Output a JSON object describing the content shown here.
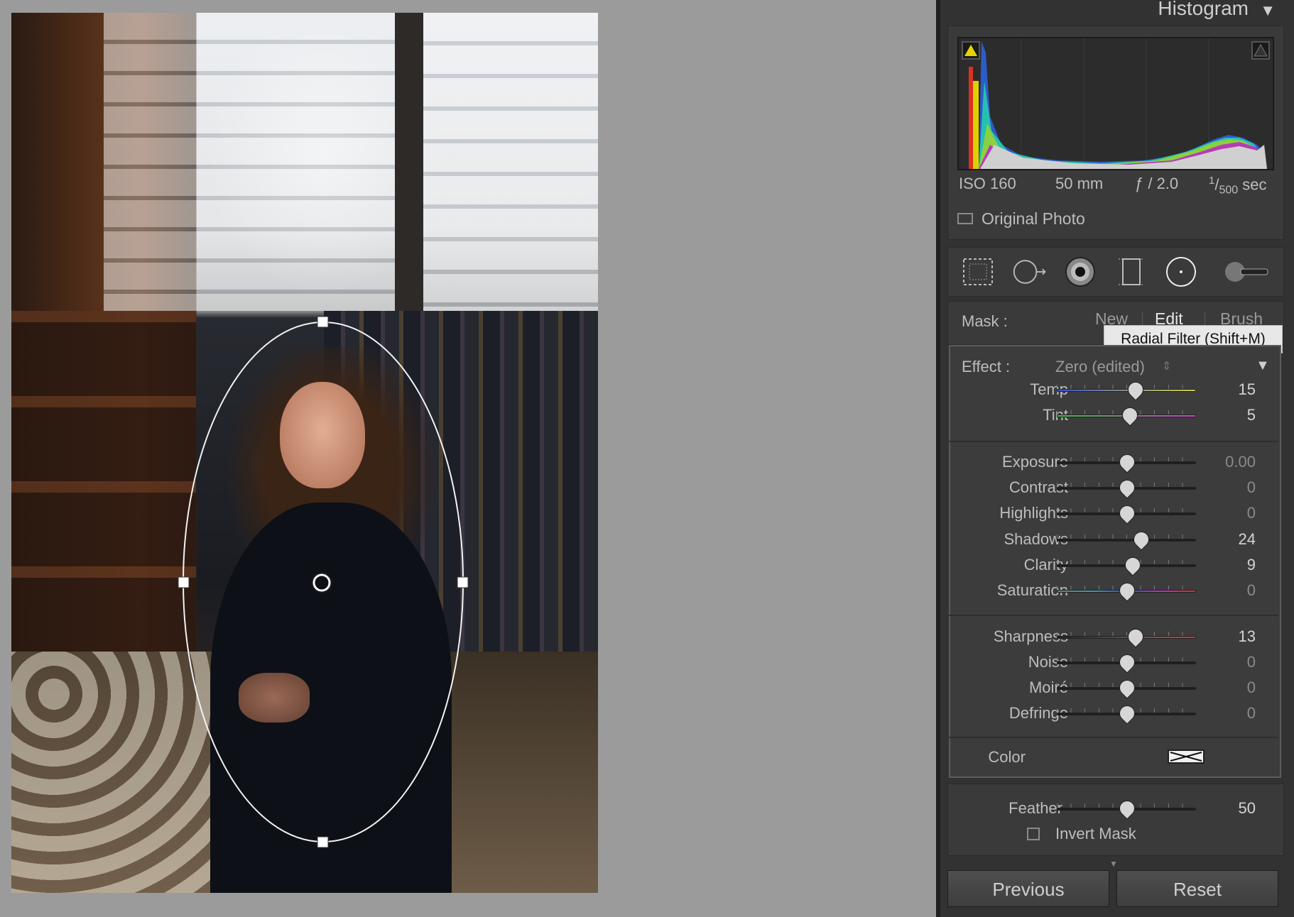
{
  "histogram": {
    "title": "Histogram",
    "collapse_glyph": "▼",
    "exif": {
      "iso": "ISO 160",
      "focal": "50 mm",
      "aperture": "ƒ / 2.0",
      "shutter_num": "1",
      "shutter_den": "500",
      "shutter_unit": "sec"
    },
    "original_photo_label": "Original Photo"
  },
  "tools": [
    "crop-overlay-icon",
    "spot-removal-icon",
    "red-eye-icon",
    "graduated-filter-icon",
    "radial-filter-icon",
    "adjustment-brush-icon"
  ],
  "mask": {
    "label": "Mask :",
    "options": [
      "New",
      "Edit",
      "Brush"
    ],
    "active": "Edit",
    "tooltip": "Radial Filter (Shift+M)"
  },
  "effect": {
    "label": "Effect :",
    "preset": "Zero (edited)",
    "preset_glyph": "⇕",
    "collapse_glyph": "▼"
  },
  "sliders_group1": [
    {
      "label": "Temp",
      "value": "15",
      "pos": 0.56
    },
    {
      "label": "Tint",
      "value": "5",
      "pos": 0.52
    }
  ],
  "sliders_group2": [
    {
      "label": "Exposure",
      "value": "0.00",
      "pos": 0.5
    },
    {
      "label": "Contrast",
      "value": "0",
      "pos": 0.5
    },
    {
      "label": "Highlights",
      "value": "0",
      "pos": 0.5
    },
    {
      "label": "Shadows",
      "value": "24",
      "pos": 0.6
    },
    {
      "label": "Clarity",
      "value": "9",
      "pos": 0.54
    },
    {
      "label": "Saturation",
      "value": "0",
      "pos": 0.5
    }
  ],
  "sliders_group3": [
    {
      "label": "Sharpness",
      "value": "13",
      "pos": 0.56
    },
    {
      "label": "Noise",
      "value": "0",
      "pos": 0.5
    },
    {
      "label": "Moiré",
      "value": "0",
      "pos": 0.5
    },
    {
      "label": "Defringe",
      "value": "0",
      "pos": 0.5
    }
  ],
  "color_label": "Color",
  "feather": {
    "label": "Feather",
    "value": "50",
    "pos": 0.5
  },
  "invert_mask_label": "Invert Mask",
  "buttons": {
    "previous": "Previous",
    "reset": "Reset"
  },
  "colors": {
    "panel": "#323232",
    "tooltip_bg": "#e8e8e8",
    "clip_warning": "#e5d400"
  }
}
